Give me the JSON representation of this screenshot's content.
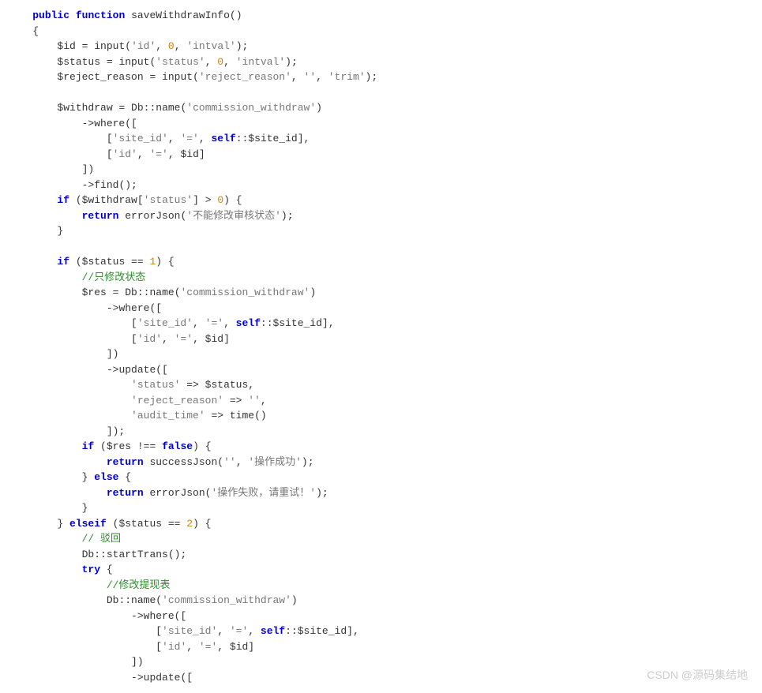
{
  "code": {
    "kw_public": "public",
    "kw_function": "function",
    "fn_name": "saveWithdrawInfo",
    "id_var": "$id",
    "status_var": "$status",
    "reject_var": "$reject_reason",
    "withdraw_var": "$withdraw",
    "res_var": "$res",
    "input_fn": "input",
    "id_str": "'id'",
    "status_str": "'status'",
    "reject_str": "'reject_reason'",
    "intval_str": "'intval'",
    "trim_str": "'trim'",
    "empty_str": "''",
    "num_0": "0",
    "num_1": "1",
    "num_2": "2",
    "db_name": "Db",
    "name_method": "name",
    "cw_str": "'commission_withdraw'",
    "where_method": "where",
    "site_id_str": "'site_id'",
    "eq_str": "'='",
    "self_kw": "self",
    "site_id_prop": "$site_id",
    "find_method": "find",
    "update_method": "update",
    "starttrans_method": "startTrans",
    "kw_if": "if",
    "kw_elseif": "elseif",
    "kw_else": "else",
    "kw_return": "return",
    "kw_try": "try",
    "kw_false": "false",
    "errorjson_fn": "errorJson",
    "successjson_fn": "successJson",
    "time_fn": "time",
    "err_msg1": "'不能修改审核状态'",
    "comment1": "//只修改状态",
    "comment2": "// 驳回",
    "comment3": "//修改提现表",
    "status_key": "'status'",
    "reject_reason_key": "'reject_reason'",
    "audit_time_key": "'audit_time'",
    "success_msg": "'操作成功'",
    "fail_msg": "'操作失败，请重试！'"
  },
  "watermark": "CSDN @源码集结地"
}
